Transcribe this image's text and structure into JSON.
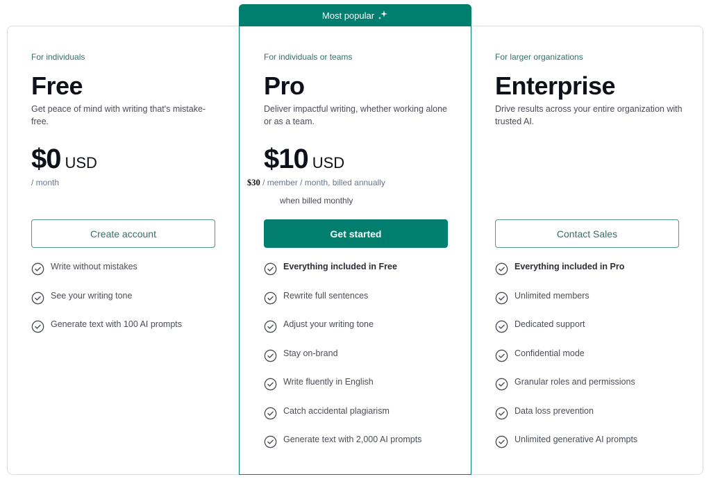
{
  "badge": {
    "label": "Most popular",
    "icon": "sparkle-icon"
  },
  "colors": {
    "brand": "#027e6f",
    "accent_text": "#31706b",
    "text_dark": "#0e101a",
    "text_muted": "#4a4d57"
  },
  "plans": [
    {
      "id": "free",
      "audience": "For individuals",
      "name": "Free",
      "description": "Get peace of mind with writing that's mistake-free.",
      "price": "$0",
      "currency": "USD",
      "period": "/ month",
      "button": "Create account",
      "features": [
        {
          "text": "Write without mistakes",
          "icon": "check-circle-icon"
        },
        {
          "text": "See your writing tone",
          "icon": "check-circle-icon"
        },
        {
          "text": "Generate text with 100 AI prompts",
          "icon": "check-circle-icon"
        }
      ]
    },
    {
      "id": "pro",
      "audience": "For individuals or teams",
      "name": "Pro",
      "description": "Deliver impactful writing, whether working alone or as a team.",
      "price": "$10",
      "currency": "USD",
      "monthly_price": "$30",
      "period": "/ member / month, billed annually",
      "period_note": "when billed monthly",
      "button": "Get started",
      "features": [
        {
          "text": "Everything included in Free",
          "icon": "check-circle-icon",
          "bold": true
        },
        {
          "text": "Rewrite full sentences",
          "icon": "check-circle-icon"
        },
        {
          "text": "Adjust your writing tone",
          "icon": "check-circle-icon"
        },
        {
          "text": "Stay on-brand",
          "icon": "check-circle-icon"
        },
        {
          "text": "Write fluently in English",
          "icon": "check-circle-icon"
        },
        {
          "text": "Catch accidental plagiarism",
          "icon": "check-circle-icon"
        },
        {
          "text": "Generate text with 2,000 AI prompts",
          "icon": "check-circle-icon"
        }
      ]
    },
    {
      "id": "enterprise",
      "audience": "For larger organizations",
      "name": "Enterprise",
      "description": "Drive results across your entire organization with trusted AI.",
      "button": "Contact Sales",
      "features": [
        {
          "text": "Everything included in Pro",
          "icon": "check-circle-icon",
          "bold": true
        },
        {
          "text": "Unlimited members",
          "icon": "check-circle-icon"
        },
        {
          "text": "Dedicated support",
          "icon": "check-circle-icon"
        },
        {
          "text": "Confidential mode",
          "icon": "check-circle-icon"
        },
        {
          "text": "Granular roles and permissions",
          "icon": "check-circle-icon"
        },
        {
          "text": "Data loss prevention",
          "icon": "check-circle-icon"
        },
        {
          "text": "Unlimited generative AI prompts",
          "icon": "check-circle-icon"
        }
      ]
    }
  ]
}
